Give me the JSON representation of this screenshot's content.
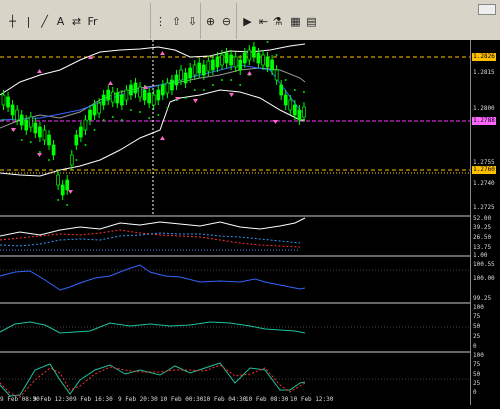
{
  "toolbar": {
    "buttons": [
      "crosshair-icon",
      "vertical-line-icon",
      "trendline-icon",
      "text-icon",
      "arrows-icon",
      "fibonacci-icon",
      "grid-icon",
      "period-separators-icon",
      "chart-up-icon",
      "chart-down-icon",
      "zoom-in-icon",
      "zoom-out-icon",
      "autoscroll-icon",
      "chart-shift-icon",
      "indicators-icon",
      "periods-icon",
      "templates-icon"
    ],
    "text_label": "A",
    "fib_label": "Fr"
  },
  "axis": {
    "main_ticks": [
      "1.2815",
      "1.2800",
      "1.2775",
      "1.2755",
      "1.2740",
      "1.2725"
    ],
    "adx_ticks": [
      "52.00",
      "39.25",
      "26.50",
      "13.75",
      "1.00"
    ],
    "ind2_ticks": [
      "100.55",
      "100.00",
      "99.25"
    ],
    "ind3_ticks": [
      "100",
      "75",
      "50",
      "25",
      "0"
    ],
    "ind4_ticks": [
      "100",
      "75",
      "50",
      "25",
      "0"
    ]
  },
  "price_boxes": {
    "top": "1.2826",
    "current": "1.2788",
    "support": "1.2760"
  },
  "colors": {
    "bg": "#000000",
    "candle": "#00ff00",
    "bands": "#ffffff",
    "sar": "#00e000",
    "fractal": "#ff66cc",
    "resistance": "#ffbf00",
    "current": "#ff00ff",
    "blue_line": "#3366ff"
  },
  "time_axis": [
    "9 Feb 08:30",
    "9 Feb 12:30",
    "9 Feb 16:30",
    "9 Feb 20:30",
    "10 Feb 00:30",
    "10 Feb 04:30",
    "10 Feb 08:30",
    "10 Feb 12:30"
  ]
}
